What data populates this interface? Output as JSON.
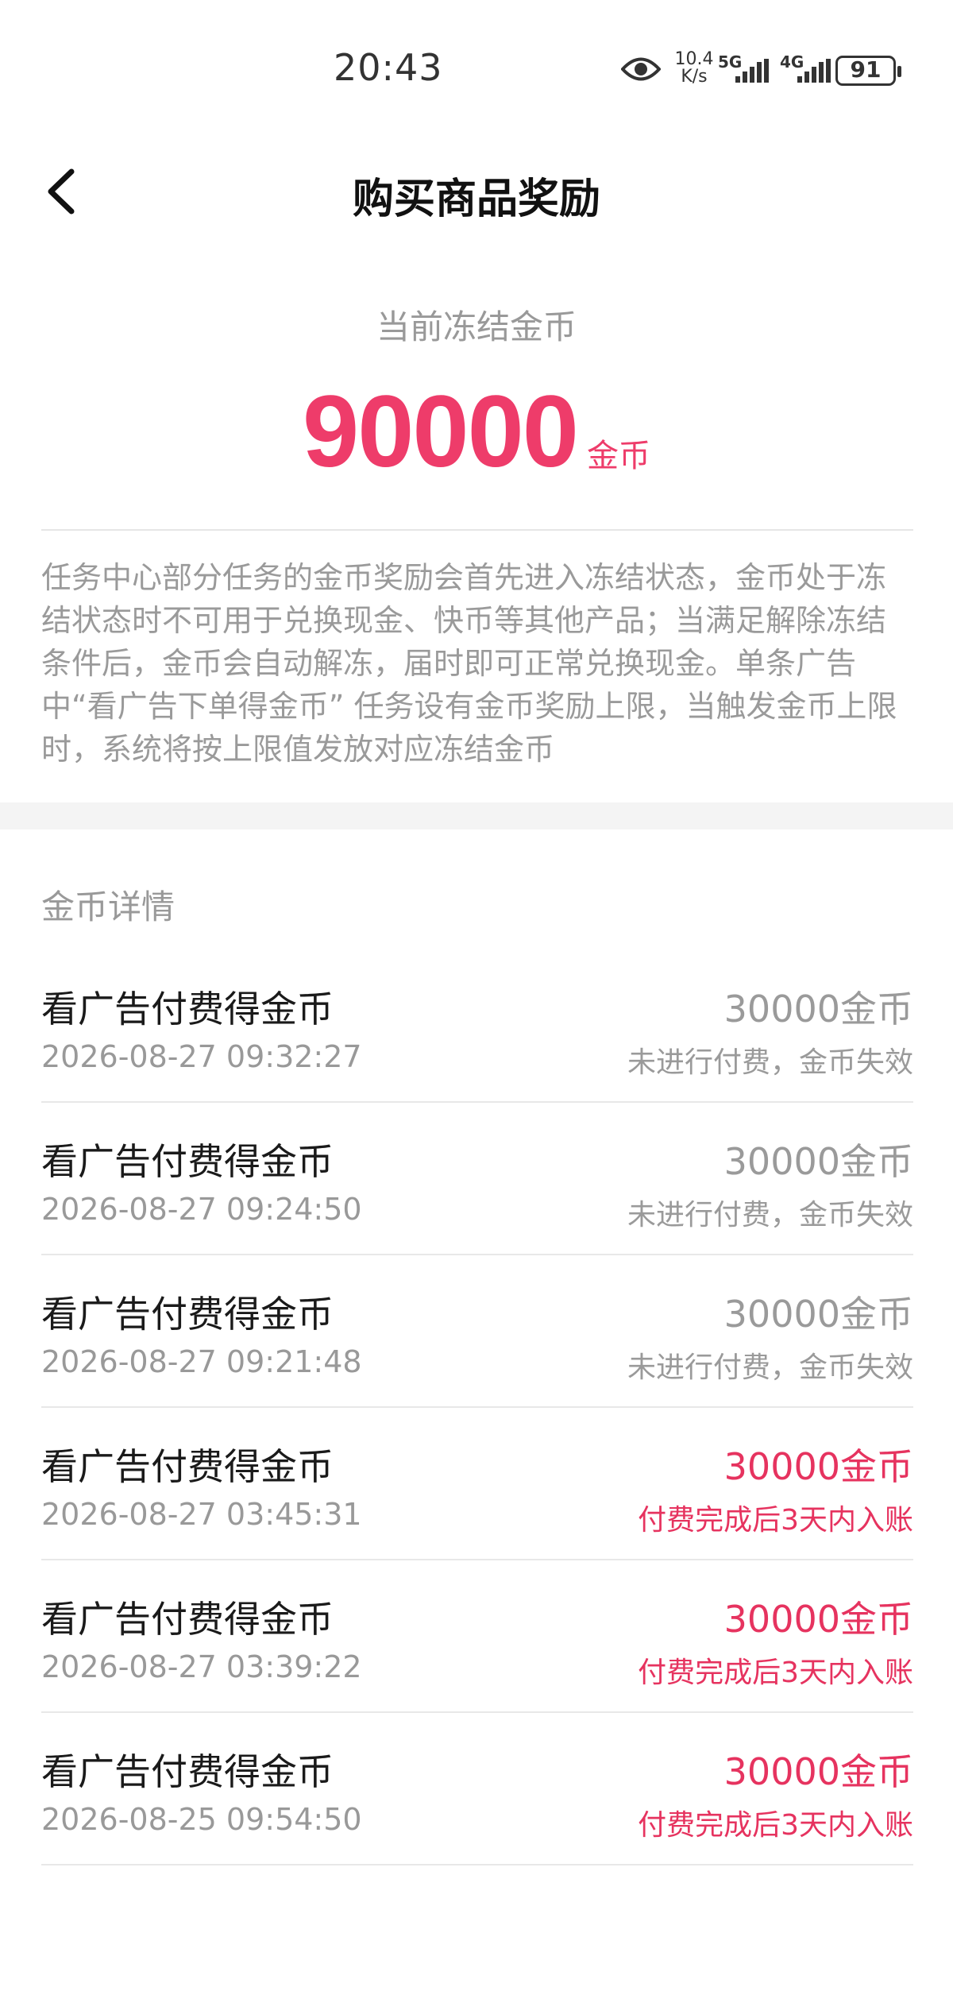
{
  "status_bar": {
    "time": "20:43",
    "speed_value": "10.4",
    "speed_unit": "K/s",
    "net1": "5G",
    "net2": "4G",
    "battery": "91",
    "icons": [
      "eye-icon",
      "signal-icon",
      "battery-icon"
    ]
  },
  "header": {
    "back_icon": "chevron-left-icon",
    "title": "购买商品奖励"
  },
  "summary": {
    "label": "当前冻结金币",
    "amount": "90000",
    "unit": "金币"
  },
  "notice": "任务中心部分任务的金币奖励会首先进入冻结状态，金币处于冻结状态时不可用于兑换现金、快币等其他产品；当满足解除冻结条件后，金币会自动解冻，届时即可正常兑换现金。单条广告中“看广告下单得金币” 任务设有金币奖励上限，当触发金币上限时，系统将按上限值发放对应冻结金币",
  "section_title": "金币详情",
  "colors": {
    "accent": "#ee3c6a",
    "muted": "#9a9a9a"
  },
  "records": [
    {
      "title": "看广告付费得金币",
      "time": "2026-08-27 09:32:27",
      "amount": "30000金币",
      "status": "未进行付费，金币失效",
      "state": "invalid"
    },
    {
      "title": "看广告付费得金币",
      "time": "2026-08-27 09:24:50",
      "amount": "30000金币",
      "status": "未进行付费，金币失效",
      "state": "invalid"
    },
    {
      "title": "看广告付费得金币",
      "time": "2026-08-27 09:21:48",
      "amount": "30000金币",
      "status": "未进行付费，金币失效",
      "state": "invalid"
    },
    {
      "title": "看广告付费得金币",
      "time": "2026-08-27 03:45:31",
      "amount": "30000金币",
      "status": "付费完成后3天内入账",
      "state": "pending"
    },
    {
      "title": "看广告付费得金币",
      "time": "2026-08-27 03:39:22",
      "amount": "30000金币",
      "status": "付费完成后3天内入账",
      "state": "pending"
    },
    {
      "title": "看广告付费得金币",
      "time": "2026-08-25 09:54:50",
      "amount": "30000金币",
      "status": "付费完成后3天内入账",
      "state": "pending"
    }
  ]
}
